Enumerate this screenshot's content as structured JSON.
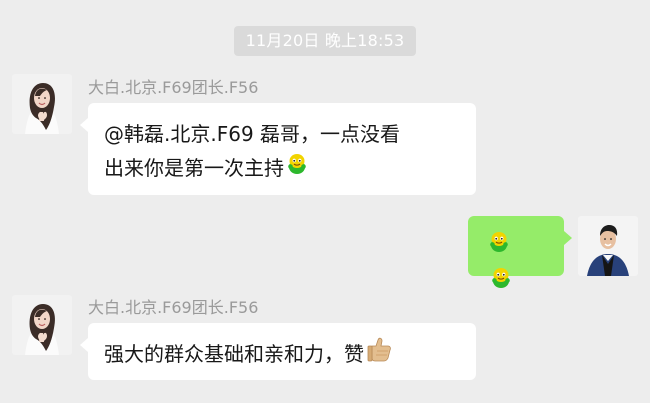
{
  "chat": {
    "timestamp": "11月20日 晚上18:53",
    "messages": [
      {
        "sender": "大白.北京.F69团长.F56",
        "line1": "@韩磊.北京.F69 磊哥，一点没看",
        "line2": "出来你是第一次主持",
        "emoji": "frog-emoji"
      },
      {
        "sender": "",
        "emoji": "frog-emoji"
      },
      {
        "sender": "大白.北京.F69团长.F56",
        "text": "强大的群众基础和亲和力，赞",
        "emoji": "thumbs-up-emoji"
      }
    ]
  },
  "colors": {
    "background": "#ededed",
    "timestamp_bg": "#dadada",
    "bubble_self": "#95ec69",
    "bubble_other": "#ffffff",
    "name_text": "#9a9a9a"
  }
}
